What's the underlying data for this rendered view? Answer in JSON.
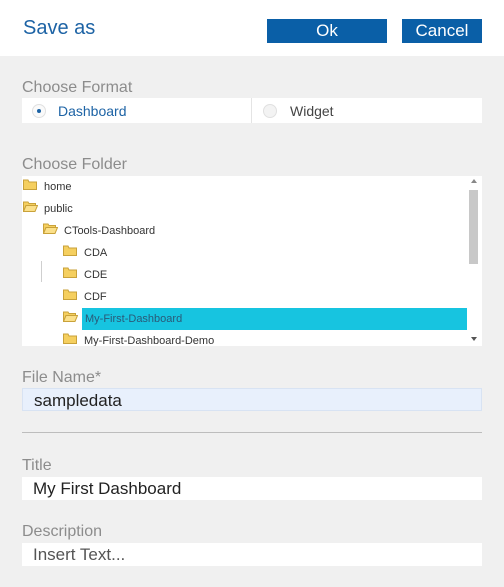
{
  "dialog": {
    "title": "Save as",
    "ok_label": "Ok",
    "cancel_label": "Cancel"
  },
  "format": {
    "label": "Choose Format",
    "options": [
      {
        "label": "Dashboard",
        "selected": true
      },
      {
        "label": "Widget",
        "selected": false
      }
    ]
  },
  "folder": {
    "label": "Choose Folder",
    "items": [
      {
        "label": "home",
        "depth": 0,
        "open": false,
        "selected": false
      },
      {
        "label": "public",
        "depth": 0,
        "open": true,
        "selected": false
      },
      {
        "label": "CTools-Dashboard",
        "depth": 1,
        "open": true,
        "selected": false
      },
      {
        "label": "CDA",
        "depth": 2,
        "open": false,
        "selected": false
      },
      {
        "label": "CDE",
        "depth": 2,
        "open": false,
        "selected": false
      },
      {
        "label": "CDF",
        "depth": 2,
        "open": false,
        "selected": false
      },
      {
        "label": "My-First-Dashboard",
        "depth": 2,
        "open": true,
        "selected": true
      },
      {
        "label": "My-First-Dashboard-Demo",
        "depth": 2,
        "open": false,
        "selected": false
      }
    ]
  },
  "file_name": {
    "label": "File Name*",
    "value": "sampledata"
  },
  "title_field": {
    "label": "Title",
    "value": "My First Dashboard"
  },
  "description": {
    "label": "Description",
    "placeholder": "Insert Text..."
  },
  "colors": {
    "accent": "#0a5fa7",
    "title_blue": "#1d63a5",
    "selection": "#17c4e0",
    "folder_yellow": "#f5cf5f"
  }
}
